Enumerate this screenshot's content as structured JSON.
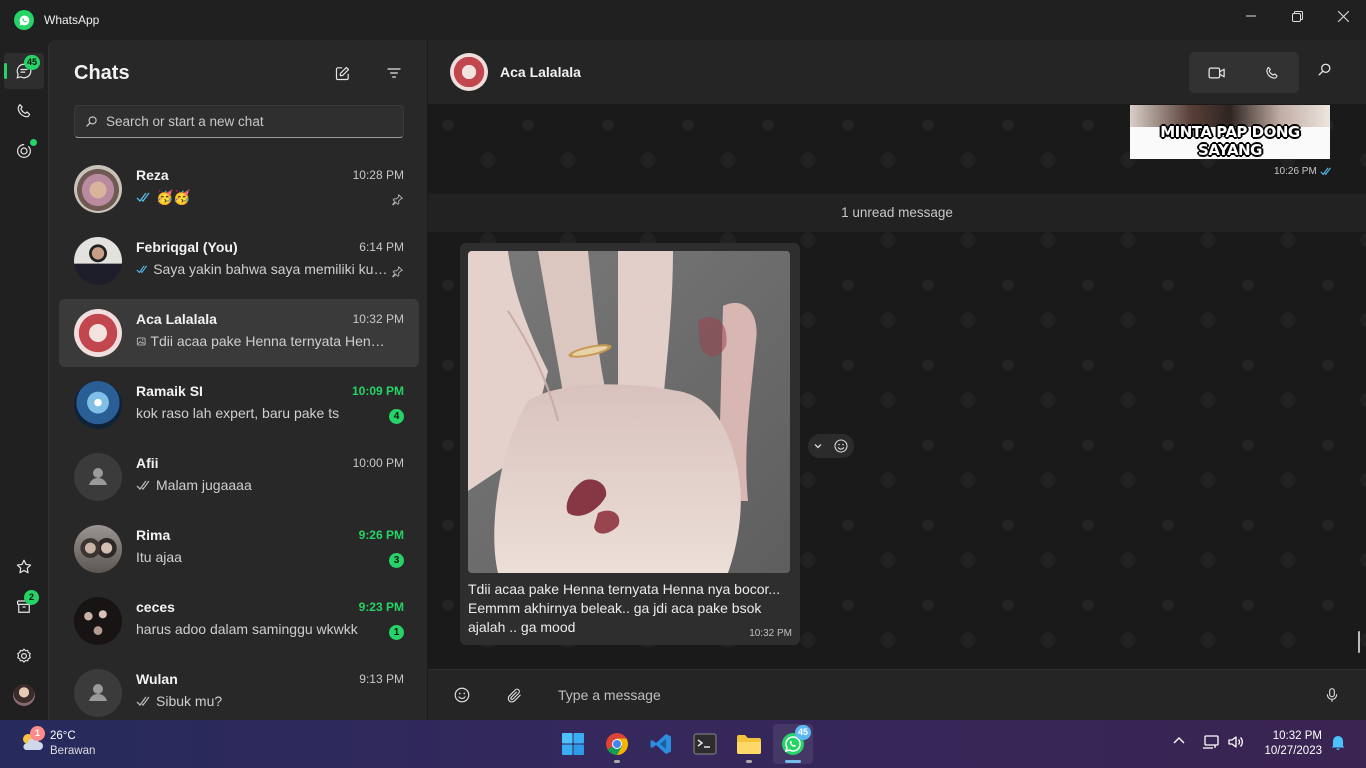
{
  "window": {
    "app_title": "WhatsApp"
  },
  "rail": {
    "chats_badge": "45",
    "archived_badge": "2"
  },
  "sidebar": {
    "title": "Chats",
    "search_placeholder": "Search or start a new chat",
    "chats": [
      {
        "name": "Reza",
        "time": "10:28 PM",
        "preview": "🥳🥳",
        "ticks": "read",
        "pinned": true
      },
      {
        "name": "Febriqgal (You)",
        "time": "6:14 PM",
        "preview": "Saya yakin bahwa saya memiliki kunci rahasia",
        "ticks": "read",
        "pinned": true
      },
      {
        "name": "Aca Lalalala",
        "time": "10:32 PM",
        "preview": "Tdii acaa pake Henna ternyata Henna nya bocor",
        "media": "image"
      },
      {
        "name": "Ramaik SI",
        "time": "10:09 PM",
        "preview": "kok raso lah expert, baru pake ts",
        "unread": "4"
      },
      {
        "name": "Afii",
        "time": "10:00 PM",
        "preview": "Malam jugaaaa",
        "ticks": "sent"
      },
      {
        "name": "Rima",
        "time": "9:26 PM",
        "preview": "Itu ajaa",
        "unread": "3"
      },
      {
        "name": "ceces",
        "time": "9:23 PM",
        "preview": "harus adoo dalam saminggu wkwkk",
        "unread": "1"
      },
      {
        "name": "Wulan",
        "time": "9:13 PM",
        "preview": "Sibuk mu?",
        "ticks": "sent"
      }
    ]
  },
  "conversation": {
    "contact_name": "Aca Lalalala",
    "sticker_text": "MINTA PAP DONG SAYANG",
    "sticker_time": "10:26 PM",
    "unread_divider": "1 unread message",
    "message": {
      "caption": "Tdii acaa pake Henna ternyata Henna nya bocor... Eemmm akhirnya beleak.. ga jdi aca pake bsok ajalah .. ga mood",
      "time": "10:32 PM"
    },
    "composer_placeholder": "Type a message"
  },
  "taskbar": {
    "weather_badge": "1",
    "temperature": "26°C",
    "condition": "Berawan",
    "whatsapp_badge": "45",
    "time": "10:32 PM",
    "date": "10/27/2023"
  },
  "colors": {
    "accent": "#25d366",
    "tick_read": "#53bdeb",
    "background": "#202020"
  }
}
